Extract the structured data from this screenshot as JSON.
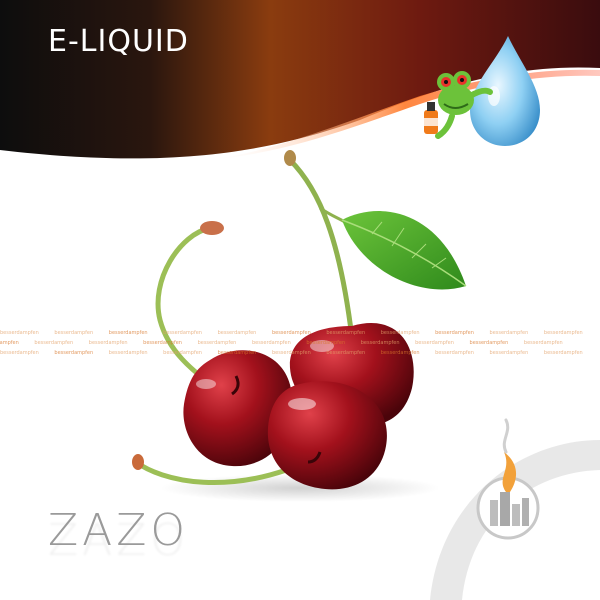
{
  "header": {
    "title": "E-LIQUID"
  },
  "watermark": {
    "text": "besserdampfen"
  },
  "brand": {
    "logo_text": "ZAZO"
  },
  "icons": {
    "mascot": "frog-drop-mascot-icon",
    "corner_logo": "flame-city-logo-icon"
  },
  "colors": {
    "banner_dark": "#1a0d0d",
    "banner_orange": "#8a3c0f",
    "banner_red": "#6e0f0f",
    "cherry_red": "#a3111c",
    "leaf_green": "#4aa82a",
    "stem_green": "#9cbf56"
  }
}
